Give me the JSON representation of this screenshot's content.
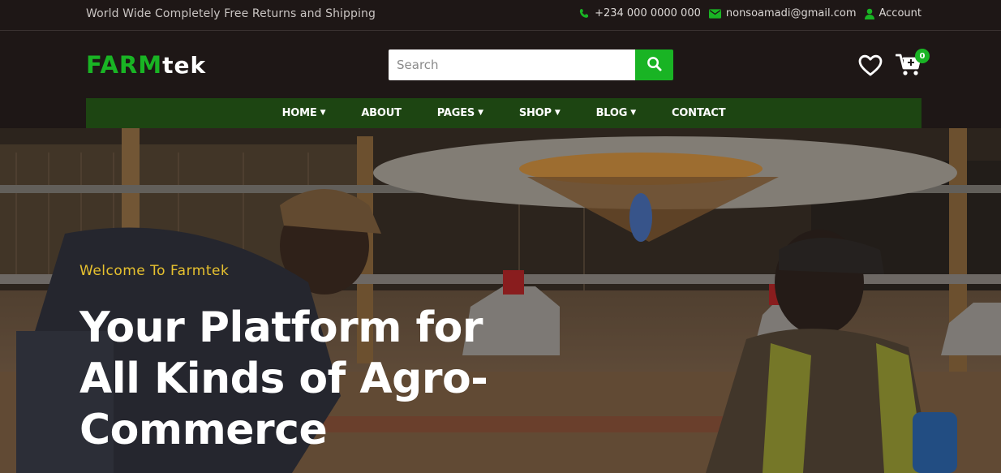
{
  "topbar": {
    "promo": "World Wide Completely Free Returns and Shipping",
    "phone": "+234 000 0000 000",
    "email": "nonsoamadi@gmail.com",
    "account": "Account"
  },
  "brand": {
    "part1": "FARM",
    "part2": "tek",
    "accent": "#19b424"
  },
  "search": {
    "placeholder": "Search",
    "value": ""
  },
  "cart": {
    "count": "0"
  },
  "nav": {
    "items": [
      {
        "label": "HOME",
        "dropdown": true
      },
      {
        "label": "ABOUT",
        "dropdown": false
      },
      {
        "label": "PAGES",
        "dropdown": true
      },
      {
        "label": "SHOP",
        "dropdown": true
      },
      {
        "label": "BLOG",
        "dropdown": true
      },
      {
        "label": "CONTACT",
        "dropdown": false
      }
    ]
  },
  "hero": {
    "welcome": "Welcome To Farmtek",
    "headline": "Your Platform for All Kinds of Agro-Commerce",
    "headline_color": "#ffffff",
    "welcome_color": "#e7c12f"
  },
  "icons": {
    "phone": "phone-icon",
    "email": "envelope-icon",
    "account": "user-icon",
    "search": "search-icon",
    "wishlist": "heart-icon",
    "cart": "cart-icon",
    "dropdown": "chevron-down-icon"
  }
}
